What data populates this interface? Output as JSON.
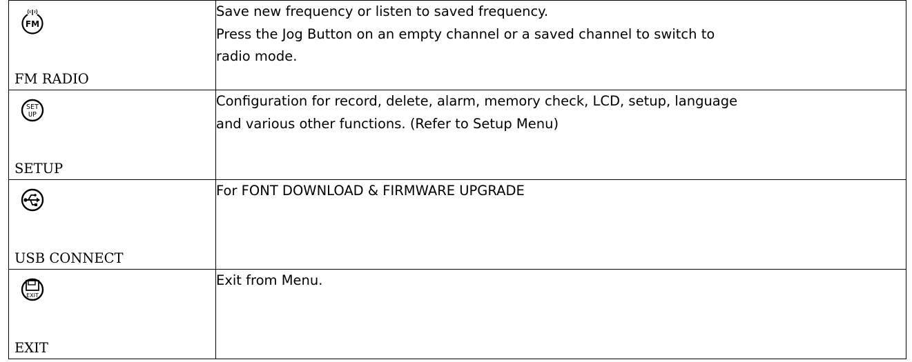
{
  "rows": [
    {
      "icon": "fm-radio-icon",
      "label": "FM RADIO",
      "lines": [
        "Save new frequency or listen to saved frequency.",
        "Press the Jog Button on an empty channel or a saved channel to switch to",
        "radio mode."
      ]
    },
    {
      "icon": "setup-icon",
      "label": "SETUP",
      "lines": [
        "Configuration for record, delete, alarm, memory check, LCD, setup, language",
        "and various other functions. (Refer to Setup Menu)"
      ]
    },
    {
      "icon": "usb-connect-icon",
      "label": "USB CONNECT",
      "lines": [
        "For FONT DOWNLOAD & FIRMWARE UPGRADE"
      ]
    },
    {
      "icon": "exit-icon",
      "label": "EXIT",
      "lines": [
        "Exit from Menu."
      ]
    }
  ],
  "icon_text": {
    "fm": "FM",
    "setup_top": "SET",
    "setup_bottom": "UP",
    "exit": "EXIT"
  }
}
